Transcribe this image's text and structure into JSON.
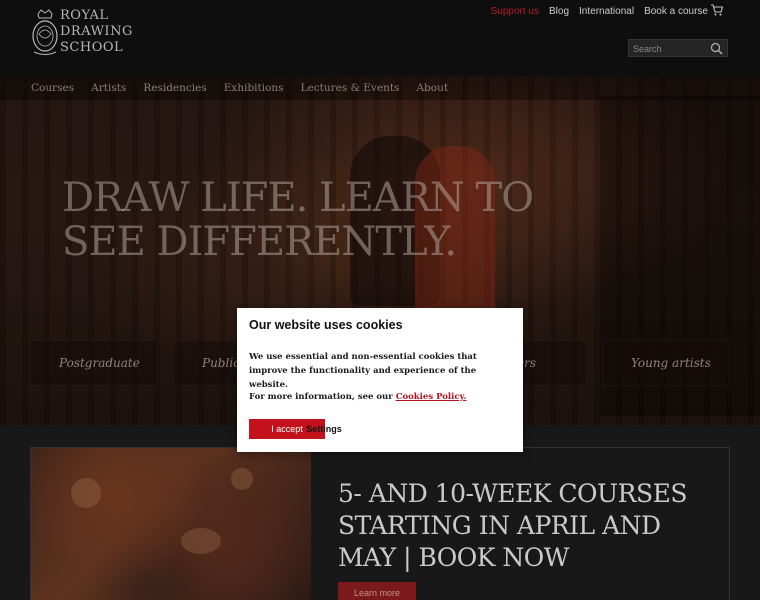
{
  "brand": {
    "logo_lines": [
      "ROYAL",
      "DRAWING",
      "SCHOOL"
    ]
  },
  "utility_nav": {
    "items": [
      "Support us",
      "Blog",
      "International",
      "Book a course"
    ],
    "cart_icon": "cart-icon"
  },
  "search": {
    "placeholder": "Search",
    "icon": "search-icon"
  },
  "main_nav": {
    "items": [
      "Courses",
      "Artists",
      "Residencies",
      "Exhibitions",
      "Lectures & Events",
      "About"
    ]
  },
  "hero": {
    "title": "DRAW LIFE. LEARN TO SEE DIFFERENTLY.",
    "categories": [
      "Postgraduate",
      "Public",
      "",
      "Leavers",
      "Young artists"
    ]
  },
  "promo": {
    "headline": "5- AND 10-WEEK COURSES STARTING IN APRIL AND MAY | BOOK NOW",
    "button_label": "Learn more"
  },
  "cookie_dialog": {
    "title": "Our website uses cookies",
    "body": "We use essential and non-essential cookies that improve the functionality and experience of the website.",
    "more_prefix": "For more information, see our",
    "policy_link": "Cookies Policy.",
    "accept_label": "I accept",
    "settings_label": "Settings"
  },
  "colors": {
    "accent_red": "#c4121c",
    "support_red": "#cc1f2c",
    "header_bg": "#111111"
  }
}
